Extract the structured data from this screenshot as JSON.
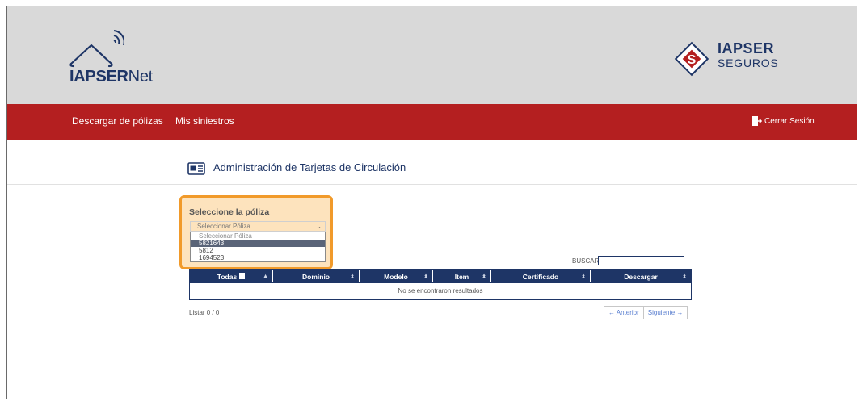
{
  "header": {
    "brand_left_bold": "IAPSER",
    "brand_left_light": "Net",
    "brand_right_line1": "IAPSER",
    "brand_right_line2": "SEGUROS"
  },
  "nav": {
    "items": [
      {
        "label": "Descargar de pólizas"
      },
      {
        "label": "Mis siniestros"
      }
    ],
    "logout_label": "Cerrar Sesión"
  },
  "page": {
    "title": "Administración de Tarjetas de Circulación"
  },
  "policy_selector": {
    "label": "Seleccione la póliza",
    "selected_value": "Seleccionar Póliza",
    "options": [
      "Seleccionar Póliza",
      "5821643",
      "5812",
      "1694523"
    ],
    "highlighted_option": "5821643"
  },
  "search": {
    "label": "BUSCAR:",
    "value": ""
  },
  "table": {
    "columns": [
      "Todas",
      "Dominio",
      "Modelo",
      "Item",
      "Certificado",
      "Descargar"
    ],
    "empty_message": "No se encontraron resultados"
  },
  "footer": {
    "listar": "Listar 0 / 0",
    "prev_label": "← Anterior",
    "next_label": "Siguiente →"
  },
  "colors": {
    "navy": "#1e3566",
    "red_bar": "#b41f20",
    "header_bg": "#d9d9d9",
    "highlight_border": "#f19a2a",
    "highlight_fill": "#fde3bd"
  }
}
